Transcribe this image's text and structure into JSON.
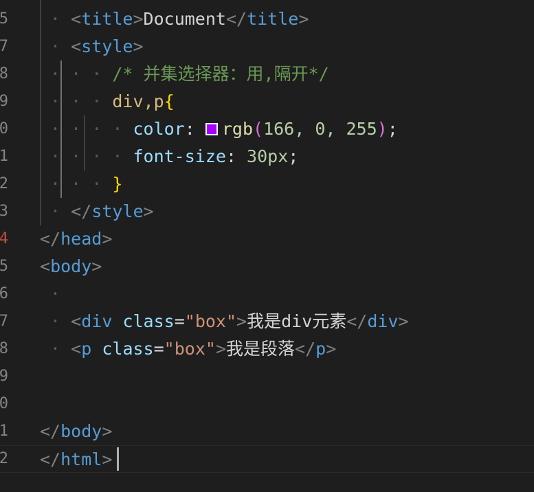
{
  "code": {
    "title_tag": "title",
    "title_text": "Document",
    "style_tag": "style",
    "comment": "/* 并集选择器：用,隔开*/",
    "selector": "div,p",
    "color_prop": "color",
    "color_value": "rgb(166, 0, 255)",
    "swatch_color": "#a600ff",
    "font_size_prop": "font-size",
    "font_size_value": "30px",
    "head_tag": "head",
    "body_tag": "body",
    "div_tag": "div",
    "p_tag": "p",
    "class_attr": "class",
    "class_value": "\"box\"",
    "div_text": "我是div元素",
    "p_text": "我是段落",
    "html_tag": "html"
  },
  "colors": {
    "background": "#1e1e1e",
    "tag": "#569cd6",
    "attribute": "#9cdcfe",
    "string": "#ce9178",
    "comment": "#6a9955",
    "selector": "#d7ba7d",
    "number": "#b5cea8"
  }
}
